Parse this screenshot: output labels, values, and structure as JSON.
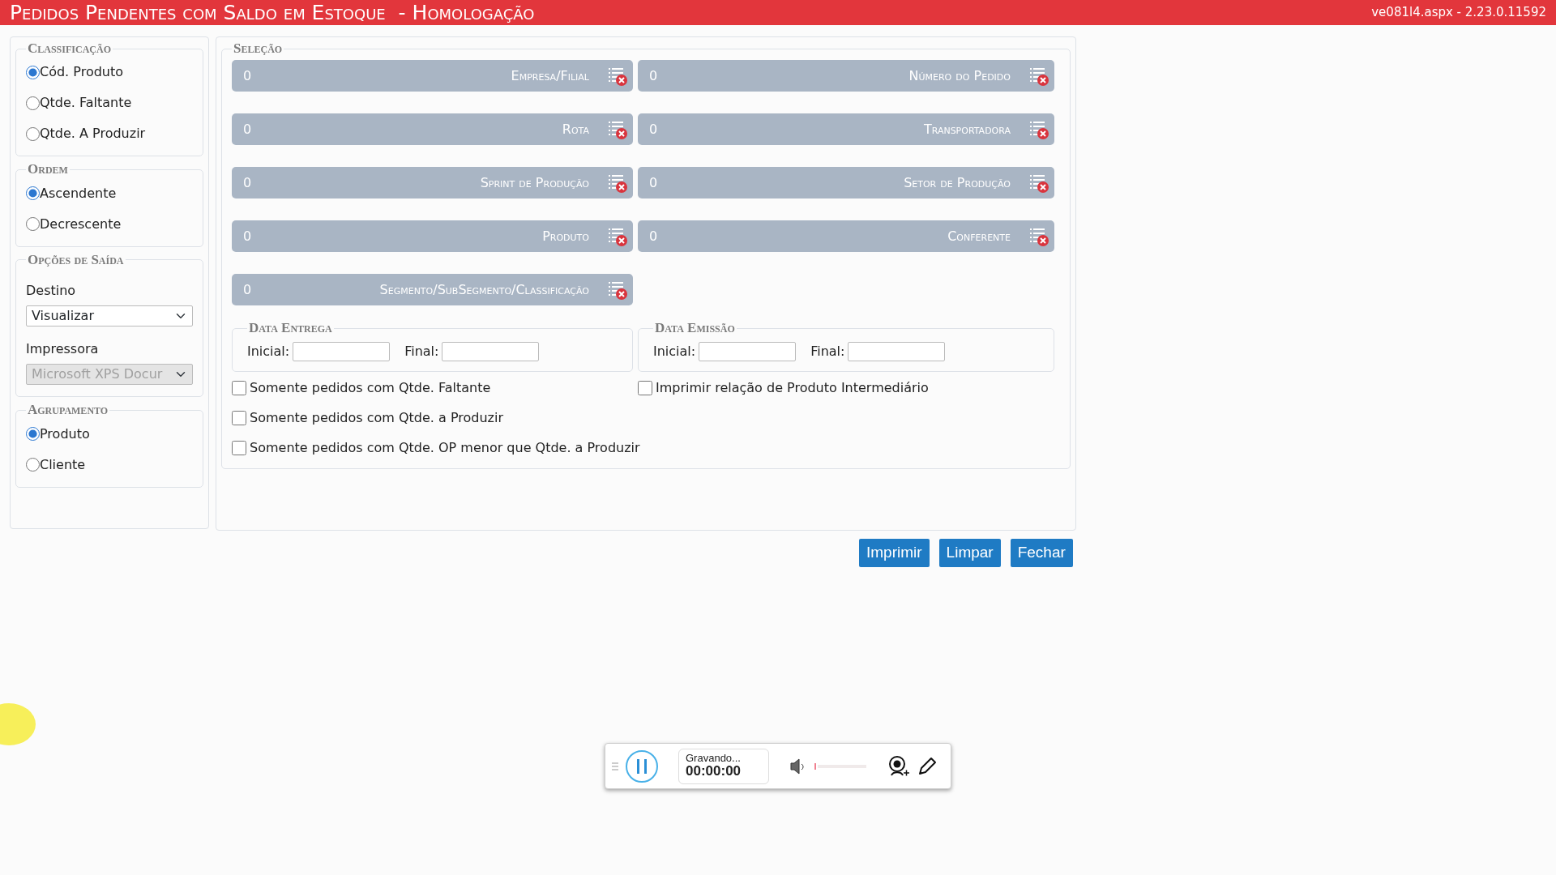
{
  "header": {
    "title": "Pedidos Pendentes com Saldo em Estoque  - Homologação",
    "version": "ve081l4.aspx - 2.23.0.11592"
  },
  "classificacao": {
    "title": "Classificação",
    "options": [
      {
        "label": "Cód. Produto",
        "selected": true
      },
      {
        "label": "Qtde. Faltante",
        "selected": false
      },
      {
        "label": "Qtde. A Produzir",
        "selected": false
      }
    ]
  },
  "ordem": {
    "title": "Ordem",
    "options": [
      {
        "label": "Ascendente",
        "selected": true
      },
      {
        "label": "Decrescente",
        "selected": false
      }
    ]
  },
  "saida": {
    "title": "Opções de Saída",
    "destino_label": "Destino",
    "destino_value": "Visualizar",
    "impressora_label": "Impressora",
    "impressora_value": "Microsoft XPS Docur",
    "impressora_disabled": true
  },
  "agrupamento": {
    "title": "Agrupamento",
    "options": [
      {
        "label": "Produto",
        "selected": true
      },
      {
        "label": "Cliente",
        "selected": false
      }
    ]
  },
  "selecao": {
    "title": "Seleção",
    "filters": [
      {
        "count": "0",
        "name": "Empresa/Filial"
      },
      {
        "count": "0",
        "name": "Número do Pedido"
      },
      {
        "count": "0",
        "name": "Rota"
      },
      {
        "count": "0",
        "name": "Transportadora"
      },
      {
        "count": "0",
        "name": "Sprint de Produção"
      },
      {
        "count": "0",
        "name": "Setor de Produção"
      },
      {
        "count": "0",
        "name": "Produto"
      },
      {
        "count": "0",
        "name": "Conferente"
      },
      {
        "count": "0",
        "name": "Segmento/SubSegmento/Classificação"
      }
    ]
  },
  "dates": [
    {
      "title": "Data Entrega",
      "inicial_label": "Inicial:",
      "final_label": "Final:"
    },
    {
      "title": "Data Emissão",
      "inicial_label": "Inicial:",
      "final_label": "Final:"
    }
  ],
  "checkbox_rows": [
    [
      {
        "label": "Somente pedidos com Qtde. Faltante",
        "checked": false
      },
      {
        "label": "Imprimir relação de Produto Intermediário",
        "checked": false
      }
    ],
    [
      {
        "label": "Somente pedidos com Qtde. a Produzir",
        "checked": false
      }
    ],
    [
      {
        "label": "Somente pedidos com Qtde. OP menor que Qtde. a Produzir",
        "checked": false
      }
    ]
  ],
  "buttons": [
    "Imprimir",
    "Limpar",
    "Fechar"
  ],
  "recorder": {
    "status": "Gravando...",
    "time": "00:00:00"
  }
}
